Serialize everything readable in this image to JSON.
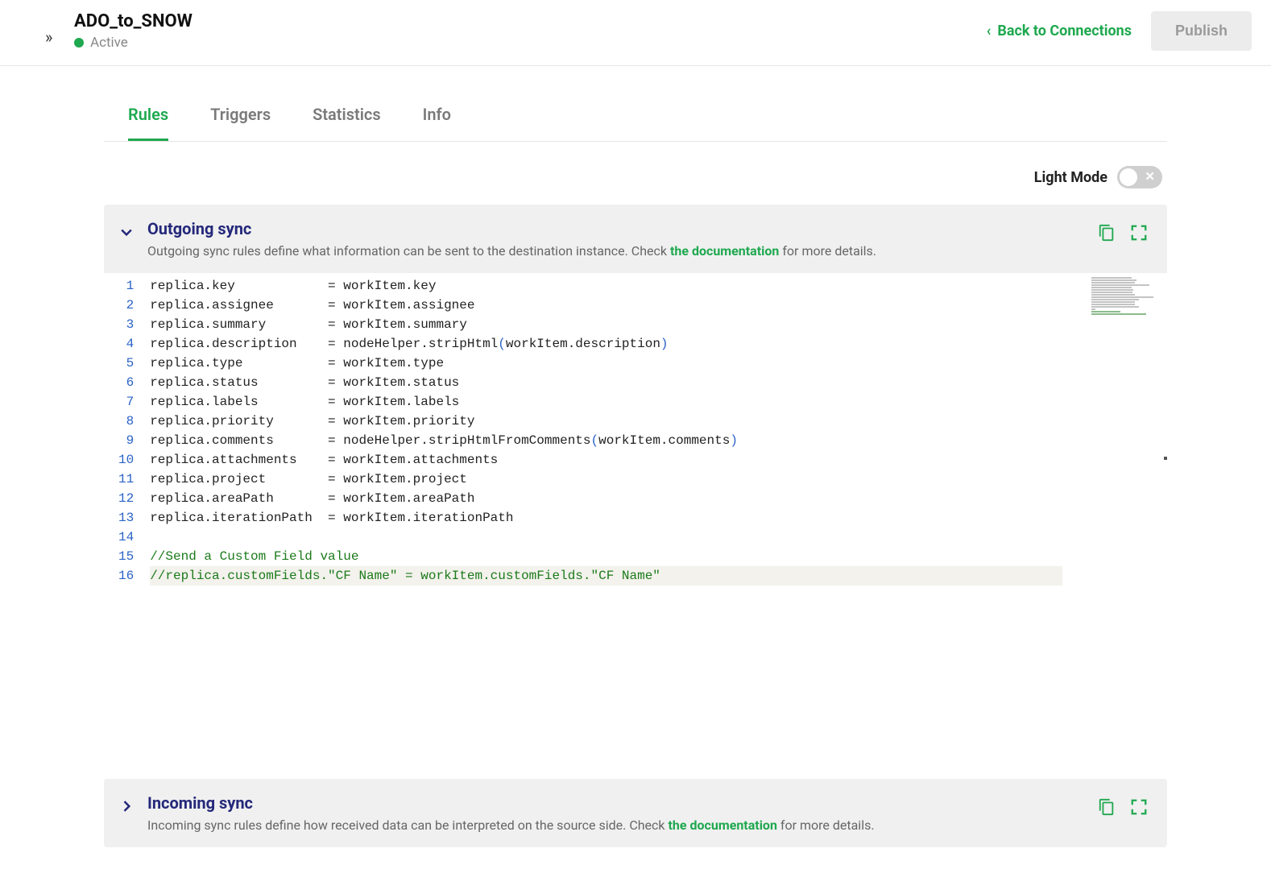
{
  "header": {
    "title": "ADO_to_SNOW",
    "status": "Active",
    "back_label": "Back to Connections",
    "publish_label": "Publish"
  },
  "tabs": [
    {
      "label": "Rules",
      "active": true
    },
    {
      "label": "Triggers",
      "active": false
    },
    {
      "label": "Statistics",
      "active": false
    },
    {
      "label": "Info",
      "active": false
    }
  ],
  "mode": {
    "label": "Light Mode",
    "on": false
  },
  "outgoing": {
    "title": "Outgoing sync",
    "desc_pre": "Outgoing sync rules define what information can be sent to the destination instance. Check ",
    "desc_link": "the documentation",
    "desc_post": " for more details.",
    "expanded": true,
    "code": [
      {
        "n": 1,
        "type": "plain",
        "text": "replica.key            = workItem.key"
      },
      {
        "n": 2,
        "type": "plain",
        "text": "replica.assignee       = workItem.assignee"
      },
      {
        "n": 3,
        "type": "plain",
        "text": "replica.summary        = workItem.summary"
      },
      {
        "n": 4,
        "type": "call",
        "pre": "replica.description    = nodeHelper.stripHtml",
        "arg": "workItem.description"
      },
      {
        "n": 5,
        "type": "plain",
        "text": "replica.type           = workItem.type"
      },
      {
        "n": 6,
        "type": "plain",
        "text": "replica.status         = workItem.status"
      },
      {
        "n": 7,
        "type": "plain",
        "text": "replica.labels         = workItem.labels"
      },
      {
        "n": 8,
        "type": "plain",
        "text": "replica.priority       = workItem.priority"
      },
      {
        "n": 9,
        "type": "call",
        "pre": "replica.comments       = nodeHelper.stripHtmlFromComments",
        "arg": "workItem.comments"
      },
      {
        "n": 10,
        "type": "plain",
        "text": "replica.attachments    = workItem.attachments"
      },
      {
        "n": 11,
        "type": "plain",
        "text": "replica.project        = workItem.project"
      },
      {
        "n": 12,
        "type": "plain",
        "text": "replica.areaPath       = workItem.areaPath"
      },
      {
        "n": 13,
        "type": "plain",
        "text": "replica.iterationPath  = workItem.iterationPath"
      },
      {
        "n": 14,
        "type": "blank",
        "text": ""
      },
      {
        "n": 15,
        "type": "comment",
        "text": "//Send a Custom Field value"
      },
      {
        "n": 16,
        "type": "comment",
        "text": "//replica.customFields.\"CF Name\" = workItem.customFields.\"CF Name\"",
        "current": true
      }
    ]
  },
  "incoming": {
    "title": "Incoming sync",
    "desc_pre": "Incoming sync rules define how received data can be interpreted on the source side. Check ",
    "desc_link": "the documentation",
    "desc_post": " for more details.",
    "expanded": false
  }
}
